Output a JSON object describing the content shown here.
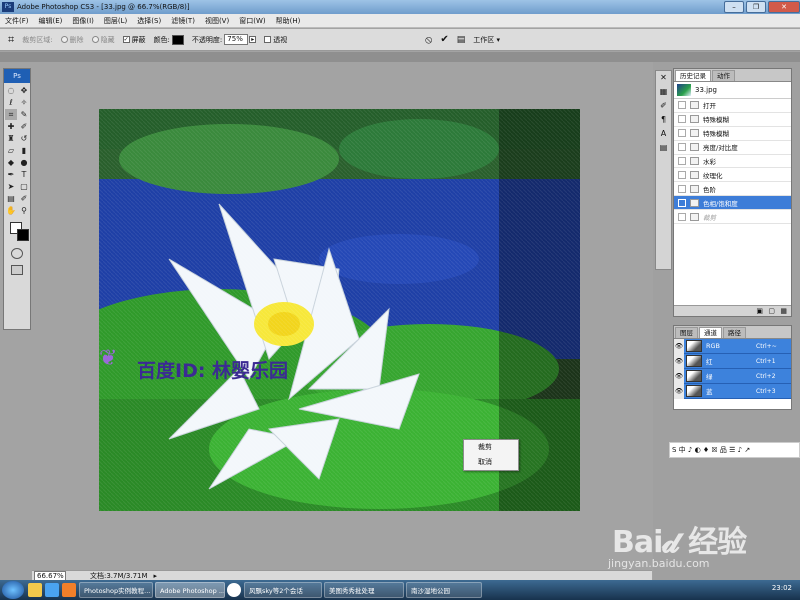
{
  "window": {
    "title": "Adobe Photoshop CS3 - [33.jpg @ 66.7%(RGB/8)]",
    "buttons": [
      "–",
      "❐",
      "✕"
    ]
  },
  "menubar": [
    "文件(F)",
    "编辑(E)",
    "图像(I)",
    "图层(L)",
    "选择(S)",
    "滤镜(T)",
    "视图(V)",
    "窗口(W)",
    "帮助(H)"
  ],
  "options": {
    "crop_area_label": "裁剪区域:",
    "delete_label": "删除",
    "hide_label": "隐藏",
    "shield_label": "屏蔽",
    "color_label": "颜色:",
    "opacity_label": "不透明度:",
    "opacity_value": "75%",
    "perspective_label": "透视",
    "cancel_icon": "⦸",
    "commit_icon": "✔",
    "workspace_label": "工作区 ▾"
  },
  "canvas": {
    "watermark": "百度ID: 林婴乐园",
    "context_menu": [
      "裁剪",
      "取消"
    ]
  },
  "status": {
    "zoom": "66.67%",
    "doc": "文档:3.7M/3.71M"
  },
  "history_panel": {
    "tabs": [
      "历史记录",
      "动作"
    ],
    "snapshot": "33.jpg",
    "items": [
      {
        "label": "打开"
      },
      {
        "label": "特殊模糊"
      },
      {
        "label": "特殊模糊"
      },
      {
        "label": "亮度/对比度"
      },
      {
        "label": "水彩"
      },
      {
        "label": "纹理化"
      },
      {
        "label": "色阶"
      },
      {
        "label": "色相/饱和度"
      },
      {
        "label": "裁剪"
      }
    ]
  },
  "channels_panel": {
    "tabs": [
      "图层",
      "通道",
      "路径"
    ],
    "channels": [
      {
        "name": "RGB",
        "shortcut": "Ctrl+~"
      },
      {
        "name": "红",
        "shortcut": "Ctrl+1"
      },
      {
        "name": "绿",
        "shortcut": "Ctrl+2"
      },
      {
        "name": "蓝",
        "shortcut": "Ctrl+3"
      }
    ]
  },
  "ime": {
    "label": "S 中 ♪ ◐ ♦ ☒ 品 ☰ ♪ ↗"
  },
  "logo": {
    "main": "Bai𝓭 经验",
    "url": "jingyan.baidu.com"
  },
  "taskbar": {
    "items": [
      "Photoshop实例教程...",
      "Adobe Photoshop ...",
      "风飘sky等2个会话",
      "美图秀秀批处理",
      "南沙湿地公园"
    ],
    "clock": "23:02"
  },
  "colors": {
    "selection": "#3d7dd8",
    "lake": "#1f3ea8",
    "leaf": "#2f9a2a"
  }
}
